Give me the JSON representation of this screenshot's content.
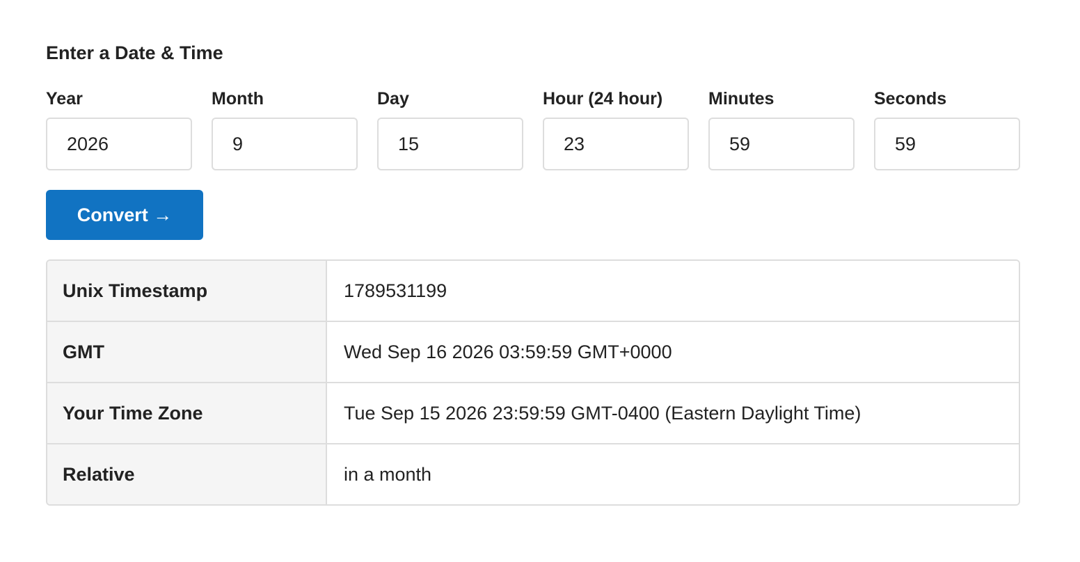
{
  "form": {
    "title": "Enter a Date & Time",
    "fields": [
      {
        "label": "Year",
        "value": "2026"
      },
      {
        "label": "Month",
        "value": "9"
      },
      {
        "label": "Day",
        "value": "15"
      },
      {
        "label": "Hour (24 hour)",
        "value": "23"
      },
      {
        "label": "Minutes",
        "value": "59"
      },
      {
        "label": "Seconds",
        "value": "59"
      }
    ],
    "convert_label": "Convert →"
  },
  "results": {
    "rows": [
      {
        "key": "Unix Timestamp",
        "value": "1789531199"
      },
      {
        "key": "GMT",
        "value": "Wed Sep 16 2026 03:59:59 GMT+0000"
      },
      {
        "key": "Your Time Zone",
        "value": "Tue Sep 15 2026 23:59:59 GMT-0400 (Eastern Daylight Time)"
      },
      {
        "key": "Relative",
        "value": "in a month"
      }
    ]
  },
  "colors": {
    "primary_button": "#1173c2",
    "table_key_background": "#f5f5f5",
    "border": "#dddddd"
  }
}
